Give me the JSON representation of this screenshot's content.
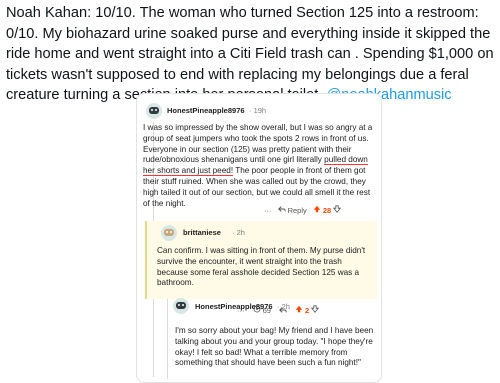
{
  "tweet": {
    "text": "Noah Kahan: 10/10. The woman who turned Section 125 into a restroom: 0/10. My biohazard urine soaked purse and everything inside it skipped the ride home and went straight into a Citi Field trash can . Spending $1,000 on tickets wasn't supposed to end with replacing my belongings due a feral creature turning a section into her personal toilet. ",
    "mention": "@noahkahanmusic"
  },
  "comment1": {
    "user": "HonestPineapple8976",
    "time": "· 19h",
    "text_before": "I was so impressed by the show overall, but I was so angry at a group of seat jumpers who took the spots 2 rows in front of us. Everyone in our section (125) was pretty patient with their rude/obnoxious shenanigans until one girl literally ",
    "text_underlined": "pulled down her shorts and just peed!",
    "text_after": " The poor people in front of them got their stuff ruined. When she was called out by the crowd, they high tailed it out of our section, but we could all smell it the rest of the night.",
    "reply_label": "Reply",
    "votes": "28"
  },
  "comment2": {
    "user": "brittaniese",
    "time": "· 2h",
    "text": "Can confirm. I was sitting in front of them. My purse didn't survive the encounter, it went straight into the trash because some feral asshole decided Section 125 was a bathroom.",
    "views": "69",
    "votes": "2"
  },
  "comment3": {
    "user": "HonestPineapple8976",
    "time": "· 2h",
    "text": "I'm so sorry about your bag! My friend and I have been talking about you and your group today. \"I hope they're okay! I felt so bad! What a terrible memory from something that should have been such a fun night!\""
  }
}
